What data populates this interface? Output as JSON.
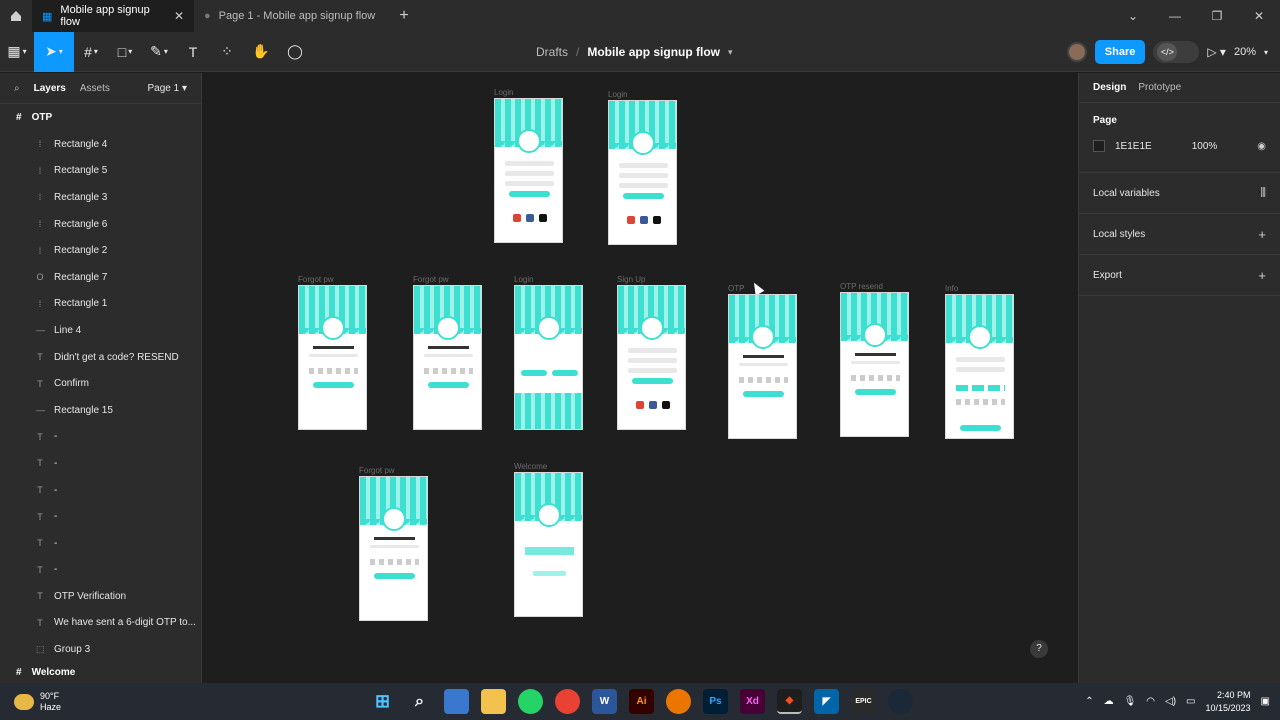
{
  "tabs": [
    {
      "label": "Mobile app signup flow",
      "active": true
    },
    {
      "label": "Page 1 - Mobile app signup flow",
      "active": false
    }
  ],
  "toolbar": {
    "breadcrumb_drafts": "Drafts",
    "breadcrumb_sep": "/",
    "file_name": "Mobile app signup flow",
    "share_label": "Share",
    "zoom": "20%"
  },
  "left_panel": {
    "tab_layers": "Layers",
    "tab_assets": "Assets",
    "page_selector": "Page 1",
    "top_frame": "OTP",
    "layers": [
      {
        "icon": "rect",
        "label": "Rectangle 4"
      },
      {
        "icon": "rect",
        "label": "Rectangle 5"
      },
      {
        "icon": "rect",
        "label": "Rectangle 3"
      },
      {
        "icon": "rect",
        "label": "Rectangle 6"
      },
      {
        "icon": "rect",
        "label": "Rectangle 2"
      },
      {
        "icon": "ellipse",
        "label": "Rectangle 7"
      },
      {
        "icon": "rect",
        "label": "Rectangle 1"
      },
      {
        "icon": "line",
        "label": "Line 4"
      },
      {
        "icon": "text",
        "label": "Didn't get a code? RESEND"
      },
      {
        "icon": "text",
        "label": "Confirm"
      },
      {
        "icon": "line",
        "label": "Rectangle 15"
      },
      {
        "icon": "text",
        "label": "-"
      },
      {
        "icon": "text",
        "label": "-"
      },
      {
        "icon": "text",
        "label": "-"
      },
      {
        "icon": "text",
        "label": "-"
      },
      {
        "icon": "text",
        "label": "-"
      },
      {
        "icon": "text",
        "label": "-"
      },
      {
        "icon": "text",
        "label": "OTP Verification"
      },
      {
        "icon": "text",
        "label": "We have sent a 6-digit OTP to..."
      },
      {
        "icon": "group",
        "label": "Group 3"
      }
    ],
    "bottom_frame": "Welcome"
  },
  "canvas": {
    "frames": [
      {
        "id": "login-1",
        "label": "Login",
        "kind": "login"
      },
      {
        "id": "login-2",
        "label": "Login",
        "kind": "login"
      },
      {
        "id": "forgot-1",
        "label": "Forgot pw",
        "kind": "forgot"
      },
      {
        "id": "forgot-2",
        "label": "Forgot pw",
        "kind": "forgot"
      },
      {
        "id": "login-3",
        "label": "Login",
        "kind": "splash"
      },
      {
        "id": "signup",
        "label": "Sign Up",
        "kind": "signup"
      },
      {
        "id": "otp",
        "label": "OTP",
        "kind": "otp"
      },
      {
        "id": "otp-resend",
        "label": "OTP resend",
        "kind": "otp"
      },
      {
        "id": "info",
        "label": "Info",
        "kind": "info"
      },
      {
        "id": "forgot-3",
        "label": "Forgot pw",
        "kind": "reset"
      },
      {
        "id": "welcome",
        "label": "Welcome",
        "kind": "welcome"
      }
    ],
    "help": "?"
  },
  "right_panel": {
    "tab_design": "Design",
    "tab_prototype": "Prototype",
    "page_title": "Page",
    "page_color": "1E1E1E",
    "page_opacity": "100%",
    "local_variables": "Local variables",
    "local_styles": "Local styles",
    "export": "Export"
  },
  "taskbar": {
    "temp": "90°F",
    "condition": "Haze",
    "time": "2:40 PM",
    "date": "10/15/2023"
  },
  "colors": {
    "accent": "#0d99ff",
    "brand_teal": "#3de0d0"
  }
}
